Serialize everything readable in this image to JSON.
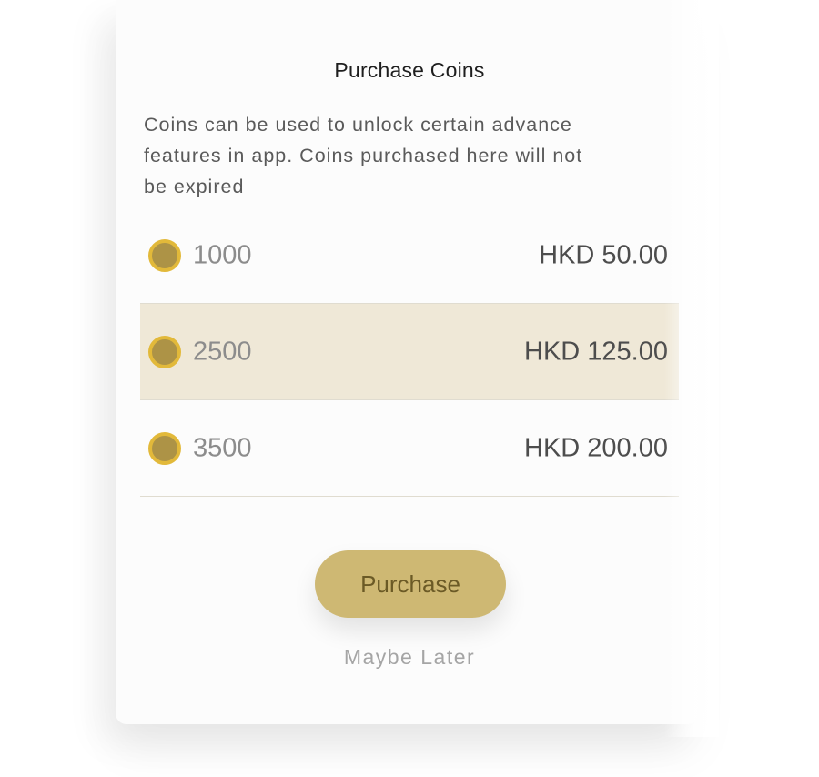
{
  "dialog": {
    "title": "Purchase Coins",
    "description_lines": [
      "Coins can be used to unlock certain advance",
      "features in app. Coins purchased here will not",
      "be expired"
    ]
  },
  "options": [
    {
      "amount": "1000",
      "price": "HKD 50.00",
      "selected": false,
      "icon": "coin-icon"
    },
    {
      "amount": "2500",
      "price": "HKD 125.00",
      "selected": true,
      "icon": "coin-icon"
    },
    {
      "amount": "3500",
      "price": "HKD 200.00",
      "selected": false,
      "icon": "coin-icon"
    }
  ],
  "actions": {
    "purchase_label": "Purchase",
    "later_label": "Maybe Later"
  },
  "colors": {
    "accent": "#ceb873",
    "selected_row": "#efe8d7",
    "coin_fill": "#ad9346",
    "coin_ring": "#e2b93a"
  }
}
